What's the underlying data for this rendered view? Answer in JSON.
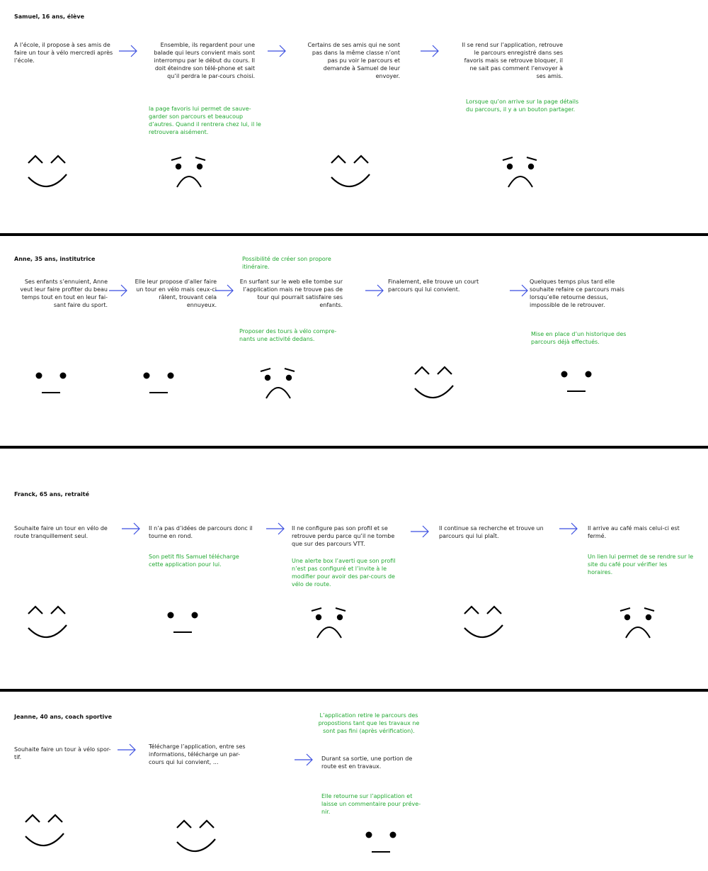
{
  "personas": [
    {
      "title": "Samuel, 16 ans, élève",
      "steps": [
        "A l’école, il propose à ses amis de faire un tour à vélo mercredi après l’école.",
        "Ensemble, ils regardent pour une balade qui leurs convient mais sont interrompu par le début du cours. Il doit éteindre son télé-phone et sait qu’il perdra le par-cours choisi.",
        "Certains de ses amis qui ne sont pas dans la même classe n’ont pas pu voir le parcours et demande à Samuel de leur envoyer.",
        "Il se rend sur l’application, retrouve le parcours enregistré dans ses favoris mais se retrouve bloquer, il ne sait pas comment l’envoyer à ses amis."
      ],
      "notes": [
        "la page favoris lui permet de sauve-garder son parcours et beaucoup d’autres. Quand il rentrera chez lui, il le retrouvera aisément.",
        "Lorsque qu’on arrive sur la page détails du parcours, il y a un bouton partager."
      ],
      "faces": [
        "happy",
        "sad",
        "happy",
        "sad"
      ]
    },
    {
      "title": "Anne, 35 ans, institutrice",
      "steps": [
        "Ses enfants s’ennuient, Anne veut leur faire profiter du beau temps tout en  tout en leur fai-sant faire du sport.",
        "Elle leur propose d’aller faire un tour en vélo mais ceux-ci râlent, trouvant cela ennuyeux.",
        "En surfant sur le web elle tombe sur l’application mais ne trouve pas de tour qui pourrait satisfaire ses enfants.",
        "Finalement, elle trouve un court parcours qui lui convient.",
        "Quelques temps plus tard elle souhaite refaire ce parcours mais lorsqu’elle retourne dessus, impossible de le retrouver."
      ],
      "notes": [
        "Possibilité de créer son propore itinéraire.",
        "Proposer des tours à vélo compre-nants une activité dedans.",
        "Mise en place d’un historique des parcours déjà effectués."
      ],
      "faces": [
        "neutral",
        "neutral",
        "sad",
        "happy",
        "neutral"
      ]
    },
    {
      "title": "Franck, 65 ans, retraité",
      "steps": [
        "Souhaite faire un tour en vélo de route tranquillement seul.",
        "Il n’a pas d’idées de parcours donc il tourne en rond.",
        "Il ne configure pas son profil et se retrouve perdu parce qu’il ne tombe que sur des parcours VTT.",
        "Il continue sa recherche et trouve un parcours qui lui plaît.",
        "Il arrive au café mais celui-ci est fermé."
      ],
      "notes": [
        "Son petit fils Samuel télécharge cette application pour lui.",
        "Une alerte box l’averti que son profil n’est pas configuré et l’invite à le modifier pour avoir des par-cours de vélo de route.",
        "Un lien lui permet de se rendre sur le site du café pour vérifier les horaires."
      ],
      "faces": [
        "happy",
        "neutral",
        "sad",
        "happy",
        "sad"
      ]
    },
    {
      "title": "Jeanne, 40 ans, coach sportive",
      "steps": [
        "Souhaite faire un tour à vélo spor-tif.",
        "Télécharge l’application, entre ses informations, télécharge un par-cours qui lui convient, ...",
        "Durant sa sortie, une portion de route est en travaux."
      ],
      "notes": [
        "L’application retire le parcours des propostions tant que les travaux ne sont pas fini (après vérification).",
        "Elle retourne sur l’application et laisse un commentaire pour préve-nir."
      ],
      "faces": [
        "happy",
        "happy",
        "neutral"
      ]
    }
  ],
  "colors": {
    "arrow": "#3a4ee0",
    "note": "#22a832",
    "divider": "#000000",
    "text": "#1a1a1a"
  }
}
